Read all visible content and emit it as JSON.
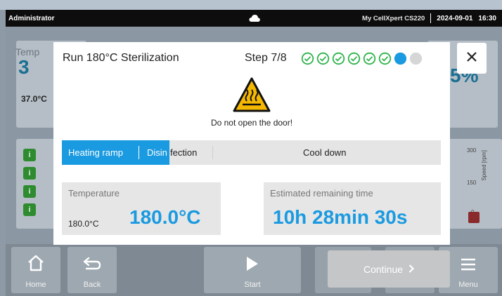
{
  "statusbar": {
    "user": "Administrator",
    "device": "My CellXpert CS220",
    "date": "2024-09-01",
    "time": "16:30"
  },
  "background": {
    "temp_label": "Temp",
    "temp_value": "3",
    "temp_setpoint": "37.0°C",
    "right_value": "5%",
    "info_icons": [
      "i",
      "i",
      "i",
      "i"
    ],
    "speed_ticks": [
      "300",
      "150",
      "0"
    ],
    "speed_axis": "Speed [rpm]"
  },
  "toolbar": {
    "home_label": "Home",
    "back_label": "Back",
    "start_label": "Start",
    "menu_label": "Menu"
  },
  "continue_label": "Continue",
  "modal": {
    "title": "Run 180°C Sterilization",
    "step_label": "Step 7/8",
    "steps": [
      {
        "state": "done"
      },
      {
        "state": "done"
      },
      {
        "state": "done"
      },
      {
        "state": "done"
      },
      {
        "state": "done"
      },
      {
        "state": "done"
      },
      {
        "state": "current"
      },
      {
        "state": "pending"
      }
    ],
    "warning_text": "Do not open the door!",
    "phases": {
      "heating": "Heating ramp",
      "disinfection_part1": "Disin",
      "disinfection_part2": "fection",
      "cooldown": "Cool down",
      "progress_fraction": 0.284
    },
    "temperature": {
      "label": "Temperature",
      "setpoint": "180.0°C",
      "value": "180.0°C"
    },
    "remaining": {
      "label": "Estimated remaining time",
      "value": "10h 28min 30s"
    }
  },
  "colors": {
    "accent_blue": "#1a9ae0",
    "done_green": "#2db34a",
    "warning_yellow": "#f5b800"
  }
}
